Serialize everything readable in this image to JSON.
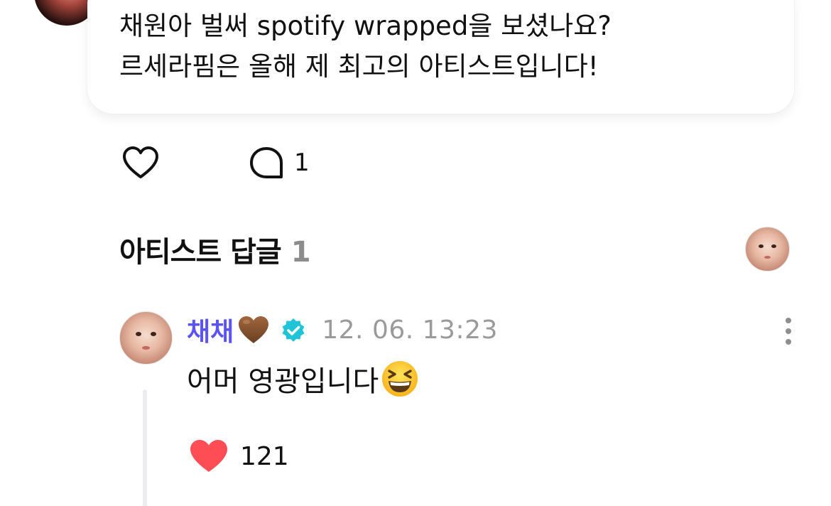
{
  "post": {
    "line1": "채원아 벌써 spotify wrapped을 보셨나요?",
    "line2": "르세라핌은 올해 제 최고의 아티스트입니다!"
  },
  "actions": {
    "like_icon": "heart-outline-icon",
    "comment_icon": "speech-bubble-icon",
    "comment_count": "1"
  },
  "artist_replies": {
    "title": "아티스트 답글",
    "count": "1"
  },
  "reply": {
    "author": "채채",
    "author_emoji": "brown-heart-icon",
    "verified_icon": "verified-badge-icon",
    "timestamp": "12. 06. 13:23",
    "text": "어머 영광입니다",
    "text_emoji": "laughing-face-icon",
    "like_count": "121",
    "colors": {
      "author": "#5b54f5",
      "verified": "#1fc5d6",
      "like_heart": "#ff4d55"
    }
  }
}
